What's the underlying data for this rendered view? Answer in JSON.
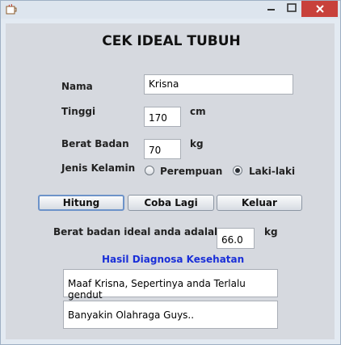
{
  "window": {
    "title": ""
  },
  "form": {
    "heading": "CEK IDEAL TUBUH",
    "nama": {
      "label": "Nama",
      "value": "Krisna"
    },
    "tinggi": {
      "label": "Tinggi",
      "value": "170",
      "unit": "cm"
    },
    "berat": {
      "label": "Berat Badan",
      "value": "70",
      "unit": "kg"
    },
    "jenis_kelamin": {
      "label": "Jenis Kelamin",
      "options": [
        "Perempuan",
        "Laki-laki"
      ],
      "selected": "Laki-laki"
    }
  },
  "buttons": {
    "hitung": "Hitung",
    "coba_lagi": "Coba Lagi",
    "keluar": "Keluar"
  },
  "result": {
    "label": "Berat badan ideal anda adalah",
    "value": "66.0",
    "unit": "kg",
    "diagnosa_heading": "Hasil Diagnosa Kesehatan",
    "diagnosa_1": "Maaf Krisna, Sepertinya anda Terlalu gendut",
    "diagnosa_2": "Banyakin Olahraga Guys.."
  }
}
